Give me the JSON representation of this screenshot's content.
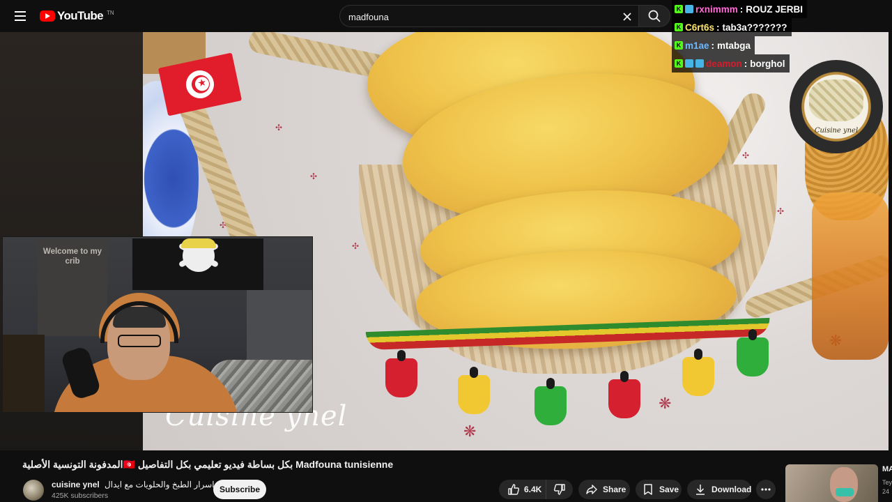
{
  "header": {
    "logo_text": "YouTube",
    "logo_suffix": "TN",
    "search_value": "madfouna"
  },
  "chat": {
    "messages": [
      {
        "user": "rxnimmm",
        "text": "ROUZ JERBI",
        "color": "#ff6bd5"
      },
      {
        "user": "C6rt6s",
        "text": "tab3a???????",
        "color": "#ffe36b"
      },
      {
        "user": "m1ae",
        "text": "mtabga",
        "color": "#6bb8ff"
      },
      {
        "user": "deamon",
        "text": "borghol",
        "color": "#d41c2c"
      }
    ]
  },
  "webcam": {
    "banner_text": "Welcome to my crib"
  },
  "video": {
    "watermark": "Cuisine ynel",
    "badge_text": "Cuisine ynel"
  },
  "info": {
    "title": "المدفونة التونسية الأصلية🇹🇳 بكل بساطة فيديو تعليمي بكل التفاصيل Madfouna tunisienne",
    "channel_name": "cuisine ynel",
    "channel_tagline": "اسرار الطبخ والحلويات مع ايدال",
    "subscribers": "425K subscribers",
    "subscribe_label": "Subscribe",
    "likes": "6.4K",
    "share_label": "Share",
    "save_label": "Save",
    "download_label": "Download"
  },
  "recommendation": {
    "title": "MA",
    "meta_1": "Tey",
    "meta_2": "24"
  }
}
